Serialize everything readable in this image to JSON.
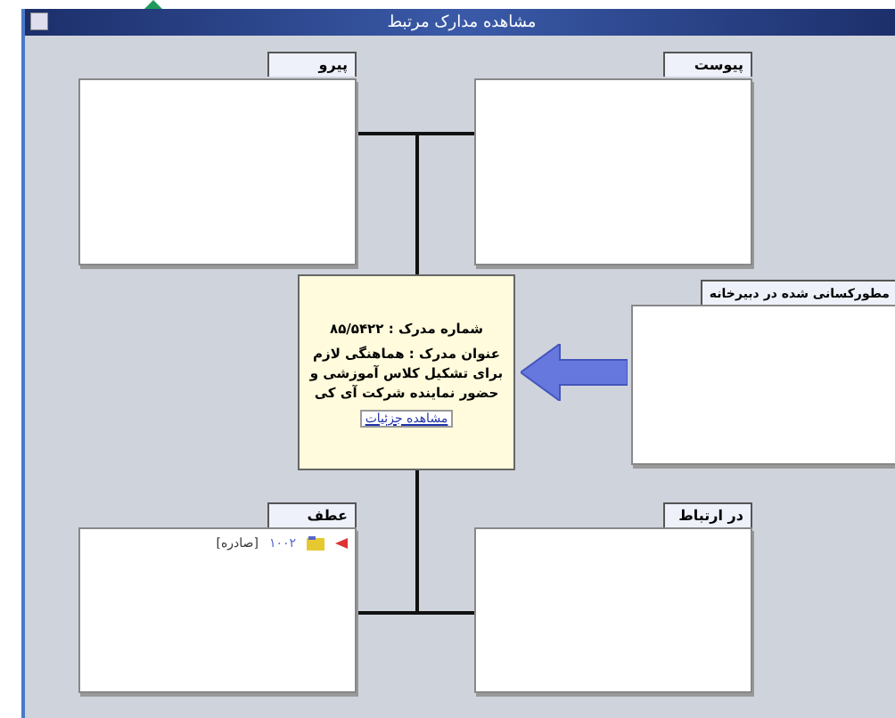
{
  "window": {
    "title": "مشاهده مدارک مرتبط"
  },
  "top_left_panel": {
    "title": "پیرو"
  },
  "top_right_panel": {
    "title": "پیوست"
  },
  "document": {
    "number_line": "شماره مدرک : ۸۵/۵۴۲۲",
    "title_line": "عنوان مدرک : هماهنگی لازم برای تشکیل کلاس آموزشی و حضور نماینده شرکت آی کی",
    "details_link": "مشاهده جزئیات"
  },
  "right_panel": {
    "title": "مطورکسانی شده در دبیرخانه"
  },
  "bottom_left_panel": {
    "title": "عطف",
    "items": [
      {
        "number": "۱۰۰۲",
        "status": "[صادره]"
      }
    ]
  },
  "bottom_right_panel": {
    "title": "در ارتباط"
  }
}
